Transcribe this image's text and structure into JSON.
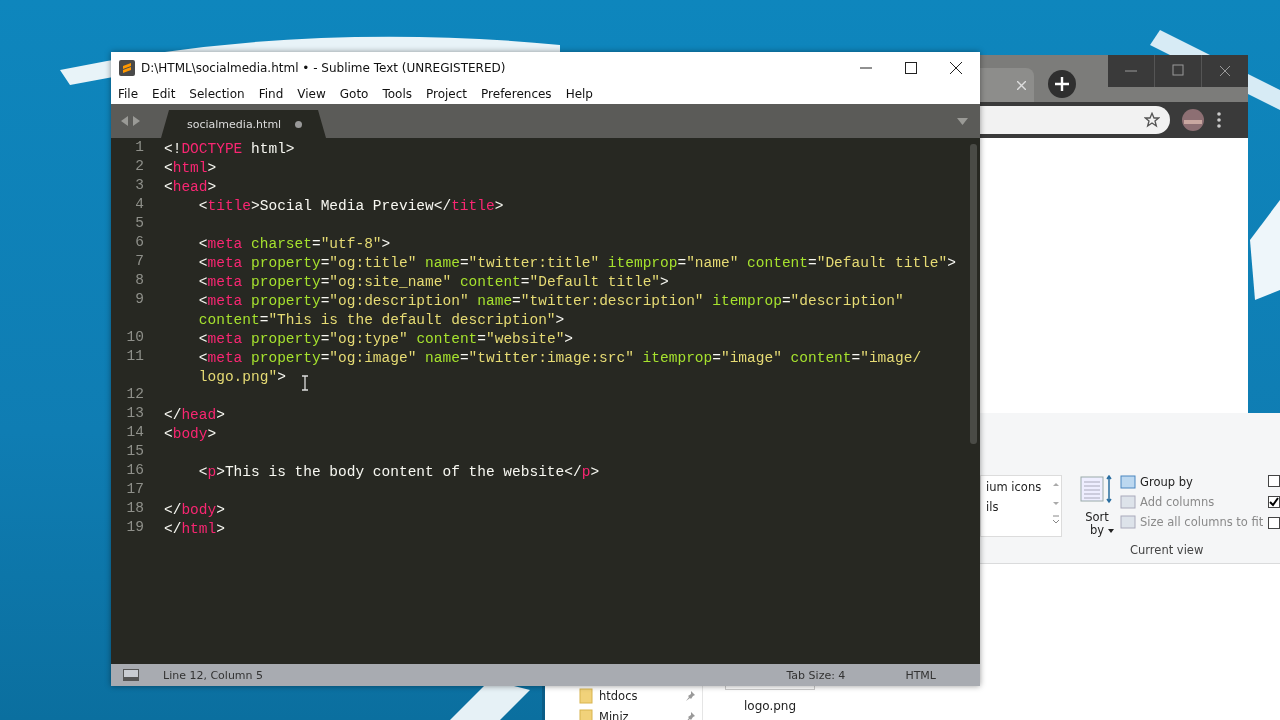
{
  "editor": {
    "title": "D:\\HTML\\socialmedia.html • - Sublime Text (UNREGISTERED)",
    "menu": [
      "File",
      "Edit",
      "Selection",
      "Find",
      "View",
      "Goto",
      "Tools",
      "Project",
      "Preferences",
      "Help"
    ],
    "tab": {
      "label": "socialmedia.html",
      "modified": true
    },
    "lines": [
      {
        "number": "1",
        "rows": [
          {
            "segments": [
              {
                "kind": "plain",
                "text": "<!"
              },
              {
                "kind": "tag",
                "text": "DOCTYPE"
              },
              {
                "kind": "plain",
                "text": " html>"
              }
            ]
          }
        ]
      },
      {
        "number": "2",
        "rows": [
          {
            "segments": [
              {
                "kind": "plain",
                "text": "<"
              },
              {
                "kind": "tag",
                "text": "html"
              },
              {
                "kind": "plain",
                "text": ">"
              }
            ]
          }
        ]
      },
      {
        "number": "3",
        "rows": [
          {
            "segments": [
              {
                "kind": "plain",
                "text": "<"
              },
              {
                "kind": "tag",
                "text": "head"
              },
              {
                "kind": "plain",
                "text": ">"
              }
            ]
          }
        ]
      },
      {
        "number": "4",
        "rows": [
          {
            "segments": [
              {
                "kind": "plain",
                "text": "    <"
              },
              {
                "kind": "tag",
                "text": "title"
              },
              {
                "kind": "plain",
                "text": ">Social Media Preview</"
              },
              {
                "kind": "tag",
                "text": "title"
              },
              {
                "kind": "plain",
                "text": ">"
              }
            ]
          }
        ]
      },
      {
        "number": "5"
      },
      {
        "number": "6",
        "rows": [
          {
            "segments": [
              {
                "kind": "plain",
                "text": "    <"
              },
              {
                "kind": "tag",
                "text": "meta"
              },
              {
                "kind": "attr",
                "text": " charset"
              },
              {
                "kind": "plain",
                "text": "="
              },
              {
                "kind": "string",
                "text": "\"utf-8\""
              },
              {
                "kind": "plain",
                "text": ">"
              }
            ]
          }
        ]
      },
      {
        "number": "7",
        "rows": [
          {
            "segments": [
              {
                "kind": "plain",
                "text": "    <"
              },
              {
                "kind": "tag",
                "text": "meta"
              },
              {
                "kind": "attr",
                "text": " property"
              },
              {
                "kind": "plain",
                "text": "="
              },
              {
                "kind": "string",
                "text": "\"og:title\""
              },
              {
                "kind": "attr",
                "text": " name"
              },
              {
                "kind": "plain",
                "text": "="
              },
              {
                "kind": "string",
                "text": "\"twitter:title\""
              },
              {
                "kind": "attr",
                "text": " itemprop"
              },
              {
                "kind": "plain",
                "text": "="
              },
              {
                "kind": "string",
                "text": "\"name\""
              },
              {
                "kind": "attr",
                "text": " content"
              },
              {
                "kind": "plain",
                "text": "="
              },
              {
                "kind": "string",
                "text": "\"Default title\""
              },
              {
                "kind": "plain",
                "text": ">"
              }
            ]
          }
        ]
      },
      {
        "number": "8",
        "rows": [
          {
            "segments": [
              {
                "kind": "plain",
                "text": "    <"
              },
              {
                "kind": "tag",
                "text": "meta"
              },
              {
                "kind": "attr",
                "text": " property"
              },
              {
                "kind": "plain",
                "text": "="
              },
              {
                "kind": "string",
                "text": "\"og:site_name\""
              },
              {
                "kind": "attr",
                "text": " content"
              },
              {
                "kind": "plain",
                "text": "="
              },
              {
                "kind": "string",
                "text": "\"Default title\""
              },
              {
                "kind": "plain",
                "text": ">"
              }
            ]
          }
        ]
      },
      {
        "number": "9",
        "rows": [
          {
            "segments": [
              {
                "kind": "plain",
                "text": "    <"
              },
              {
                "kind": "tag",
                "text": "meta"
              },
              {
                "kind": "attr",
                "text": " property"
              },
              {
                "kind": "plain",
                "text": "="
              },
              {
                "kind": "string",
                "text": "\"og:description\""
              },
              {
                "kind": "attr",
                "text": " name"
              },
              {
                "kind": "plain",
                "text": "="
              },
              {
                "kind": "string",
                "text": "\"twitter:description\""
              },
              {
                "kind": "attr",
                "text": " itemprop"
              },
              {
                "kind": "plain",
                "text": "="
              },
              {
                "kind": "string",
                "text": "\"description\""
              }
            ]
          },
          {
            "segments": [
              {
                "kind": "attr",
                "text": "    content"
              },
              {
                "kind": "plain",
                "text": "="
              },
              {
                "kind": "string",
                "text": "\"This is the default description\""
              },
              {
                "kind": "plain",
                "text": ">"
              }
            ]
          }
        ]
      },
      {
        "number": "10",
        "rows": [
          {
            "segments": [
              {
                "kind": "plain",
                "text": "    <"
              },
              {
                "kind": "tag",
                "text": "meta"
              },
              {
                "kind": "attr",
                "text": " property"
              },
              {
                "kind": "plain",
                "text": "="
              },
              {
                "kind": "string",
                "text": "\"og:type\""
              },
              {
                "kind": "attr",
                "text": " content"
              },
              {
                "kind": "plain",
                "text": "="
              },
              {
                "kind": "string",
                "text": "\"website\""
              },
              {
                "kind": "plain",
                "text": ">"
              }
            ]
          }
        ]
      },
      {
        "number": "11",
        "rows": [
          {
            "segments": [
              {
                "kind": "plain",
                "text": "    <"
              },
              {
                "kind": "tag",
                "text": "meta"
              },
              {
                "kind": "attr",
                "text": " property"
              },
              {
                "kind": "plain",
                "text": "="
              },
              {
                "kind": "string",
                "text": "\"og:image\""
              },
              {
                "kind": "attr",
                "text": " name"
              },
              {
                "kind": "plain",
                "text": "="
              },
              {
                "kind": "string",
                "text": "\"twitter:image:src\""
              },
              {
                "kind": "attr",
                "text": " itemprop"
              },
              {
                "kind": "plain",
                "text": "="
              },
              {
                "kind": "string",
                "text": "\"image\""
              },
              {
                "kind": "attr",
                "text": " content"
              },
              {
                "kind": "plain",
                "text": "="
              },
              {
                "kind": "string",
                "text": "\"image/"
              }
            ]
          },
          {
            "segments": [
              {
                "kind": "string",
                "text": "    logo.png\""
              },
              {
                "kind": "plain",
                "text": ">"
              }
            ]
          }
        ]
      },
      {
        "number": "12"
      },
      {
        "number": "13",
        "rows": [
          {
            "segments": [
              {
                "kind": "plain",
                "text": "</"
              },
              {
                "kind": "tag",
                "text": "head"
              },
              {
                "kind": "plain",
                "text": ">"
              }
            ]
          }
        ]
      },
      {
        "number": "14",
        "rows": [
          {
            "segments": [
              {
                "kind": "plain",
                "text": "<"
              },
              {
                "kind": "tag",
                "text": "body"
              },
              {
                "kind": "plain",
                "text": ">"
              }
            ]
          }
        ]
      },
      {
        "number": "15"
      },
      {
        "number": "16",
        "rows": [
          {
            "segments": [
              {
                "kind": "plain",
                "text": "    <"
              },
              {
                "kind": "tag",
                "text": "p"
              },
              {
                "kind": "plain",
                "text": ">This is the body content of the website</"
              },
              {
                "kind": "tag",
                "text": "p"
              },
              {
                "kind": "plain",
                "text": ">"
              }
            ]
          }
        ]
      },
      {
        "number": "17"
      },
      {
        "number": "18",
        "rows": [
          {
            "segments": [
              {
                "kind": "plain",
                "text": "</"
              },
              {
                "kind": "tag",
                "text": "body"
              },
              {
                "kind": "plain",
                "text": ">"
              }
            ]
          }
        ]
      },
      {
        "number": "19",
        "rows": [
          {
            "segments": [
              {
                "kind": "plain",
                "text": "</"
              },
              {
                "kind": "tag",
                "text": "html"
              },
              {
                "kind": "plain",
                "text": ">"
              }
            ]
          }
        ]
      }
    ],
    "status": {
      "position": "Line 12, Column 5",
      "tab_size": "Tab Size: 4",
      "syntax": "HTML"
    }
  },
  "explorer": {
    "layouts": [
      "ium icons",
      "ils"
    ],
    "sort_by": "Sort by",
    "commands": [
      {
        "label": "Group by",
        "disabled": false
      },
      {
        "label": "Add columns",
        "disabled": true
      },
      {
        "label": "Size all columns to fit",
        "disabled": true
      }
    ],
    "group_label": "Current view",
    "checkboxes": [
      {
        "checked": false
      },
      {
        "checked": true
      },
      {
        "checked": false
      }
    ],
    "nav_items": [
      "htdocs",
      "Miniz"
    ],
    "files": [
      "logo.png"
    ]
  }
}
